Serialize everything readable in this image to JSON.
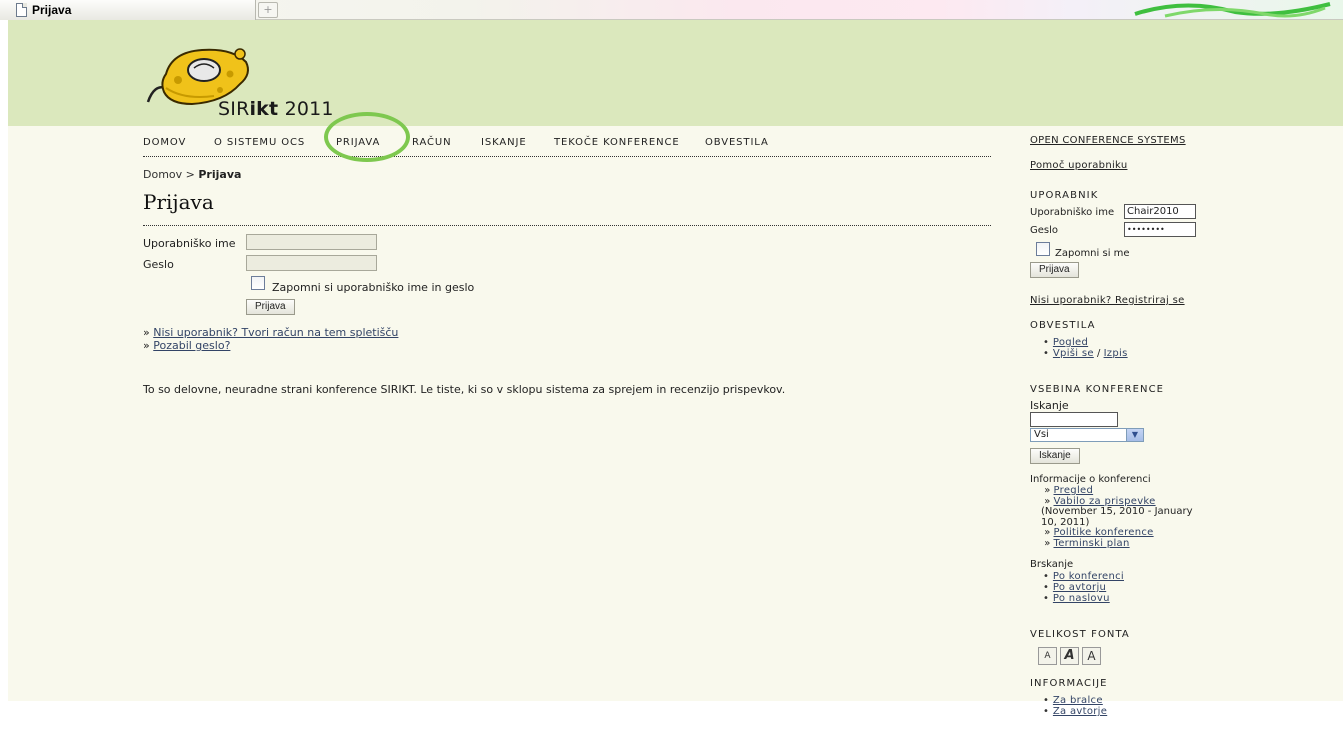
{
  "browser": {
    "tab_title": "Prijava",
    "new_tab_label": "+"
  },
  "brand": {
    "logo_prefix": "SIR",
    "logo_bold": "ikt",
    "logo_year": "2011"
  },
  "nav": {
    "items": [
      "DOMOV",
      "O SISTEMU OCS",
      "PRIJAVA",
      "RAČUN",
      "ISKANJE",
      "TEKOČE KONFERENCE",
      "OBVESTILA"
    ],
    "highlight_color": "#7ec84f"
  },
  "breadcrumb": {
    "home": "Domov",
    "separator": ">",
    "current": "Prijava"
  },
  "main": {
    "title": "Prijava",
    "username_label": "Uporabniško ime",
    "username_value": "",
    "password_label": "Geslo",
    "password_value": "",
    "remember_label": "Zapomni si uporabniško ime in geslo",
    "login_button": "Prijava",
    "link_prefix": "»",
    "register_link": "Nisi uporabnik? Tvori račun na tem spletišču",
    "forgot_link": "Pozabil geslo?",
    "notice": "To so delovne, neuradne strani konference SIRIKT. Le tiste, ki so v sklopu sistema za sprejem in recenzijo prispevkov."
  },
  "sidebar": {
    "ocs_link": "OPEN CONFERENCE SYSTEMS",
    "help_link": "Pomoč uporabniku",
    "user_heading": "UPORABNIK",
    "username_label": "Uporabniško ime",
    "username_value": "Chair2010",
    "password_label": "Geslo",
    "password_value": "••••••••",
    "remember_label": "Zapomni si me",
    "login_button": "Prijava",
    "register_link": "Nisi uporabnik? Registriraj se",
    "notices_heading": "OBVESTILA",
    "notices_view": "Pogled",
    "notices_subscribe": "Vpiši se",
    "notices_slash": "/",
    "notices_unsubscribe": "Izpis",
    "content_heading": "VSEBINA KONFERENCE",
    "search_label": "Iskanje",
    "search_value": "",
    "search_scope": "Vsi",
    "search_button": "Iskanje",
    "info_heading": "Informacije o konferenci",
    "info_prefix": "»",
    "info_overview": "Pregled",
    "info_cfp": "Vabilo za prispevke",
    "info_dates_1": "(November 15, 2010 - January",
    "info_dates_2": "10, 2011)",
    "info_policies": "Politike konference",
    "info_schedule": "Terminski plan",
    "browse_heading": "Brskanje",
    "browse_conference": "Po konferenci",
    "browse_author": "Po avtorju",
    "browse_title": "Po naslovu",
    "font_heading": "VELIKOST FONTA",
    "font_small": "A",
    "font_default": "A",
    "font_large": "A",
    "information_heading": "INFORMACIJE",
    "info_readers": "Za bralce",
    "info_authors": "Za avtorje"
  }
}
